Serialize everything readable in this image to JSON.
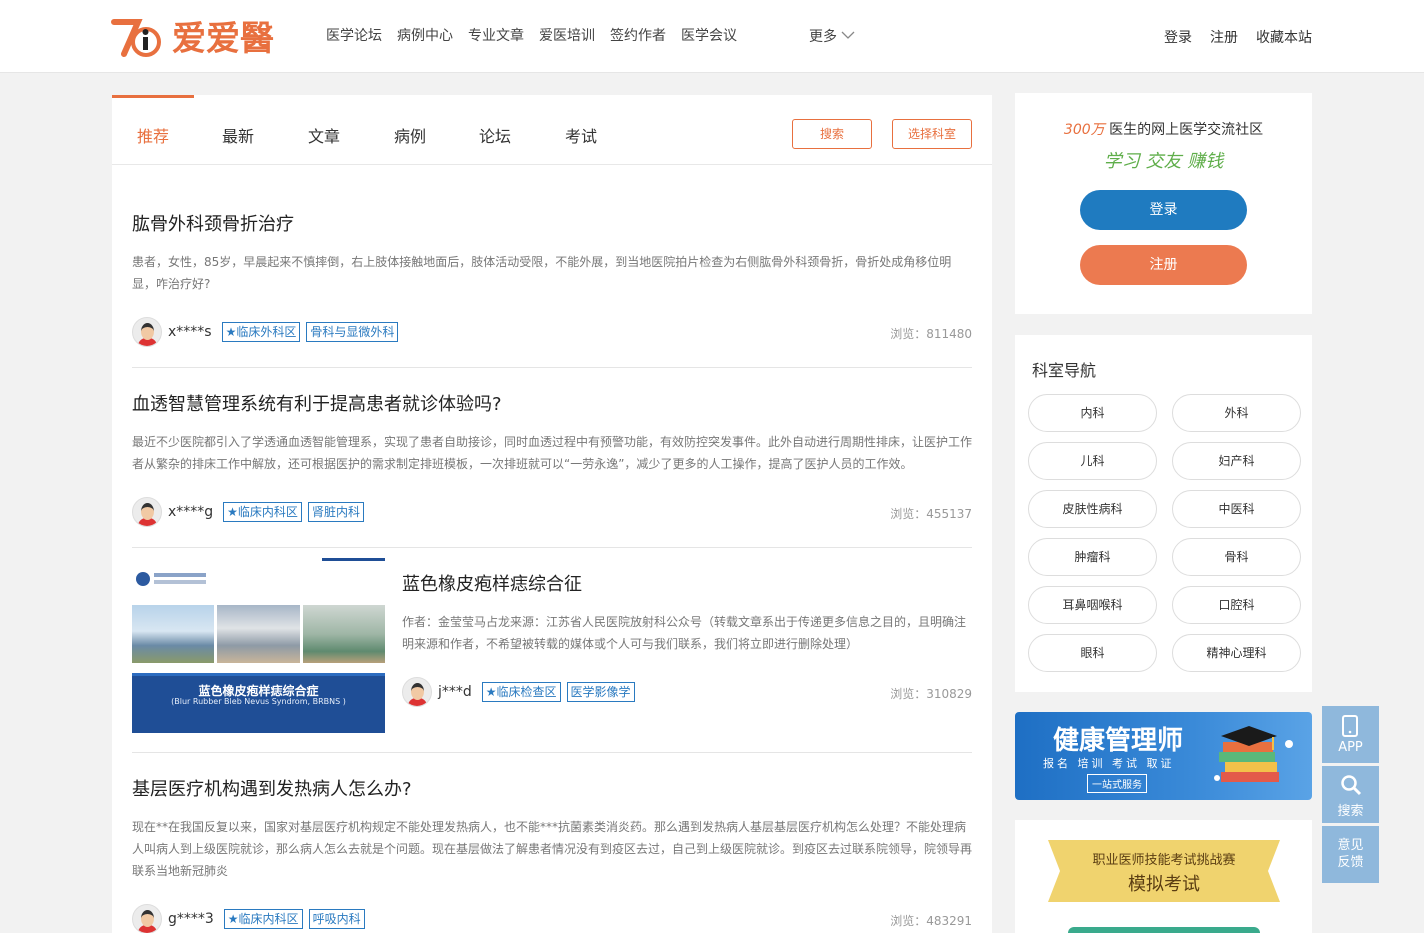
{
  "brand": {
    "logo_text": "爱爱醫"
  },
  "nav": {
    "items": [
      "医学论坛",
      "病例中心",
      "专业文章",
      "爱医培训",
      "签约作者",
      "医学会议"
    ],
    "more": "更多"
  },
  "toplinks": {
    "login": "登录",
    "register": "注册",
    "bookmark": "收藏本站"
  },
  "tabs": {
    "items": [
      "推荐",
      "最新",
      "文章",
      "病例",
      "论坛",
      "考试"
    ],
    "active": "推荐",
    "search_btn": "搜索",
    "choose_dept_btn": "选择科室"
  },
  "posts": [
    {
      "title": "肱骨外科颈骨折治疗",
      "excerpt": "患者，女性，85岁，早晨起来不慎摔倒，右上肢体接触地面后，肢体活动受限，不能外展，到当地医院拍片检查为右侧肱骨外科颈骨折，骨折处成角移位明显，咋治疗好?",
      "user": "x****s",
      "tags": [
        "★临床外科区",
        "骨科与显微外科"
      ],
      "views": "浏览：811480"
    },
    {
      "title": "血透智慧管理系统有利于提高患者就诊体验吗?",
      "excerpt": "最近不少医院都引入了学透通血透智能管理系，实现了患者自助接诊，同时血透过程中有预警功能，有效防控突发事件。此外自动进行周期性排床，让医护工作者从繁杂的排床工作中解放，还可根据医护的需求制定排班模板，一次排班就可以“一劳永逸”，减少了更多的人工操作，提高了医护人员的工作效。",
      "user": "x****g",
      "tags": [
        "★临床内科区",
        "肾脏内科"
      ],
      "views": "浏览：455137"
    },
    {
      "title": "蓝色橡皮疱样痣综合征",
      "excerpt": "作者：金莹莹马占龙来源：江苏省人民医院放射科公众号（转载文章系出于传递更多信息之目的，且明确注明来源和作者，不希望被转载的媒体或个人可与我们联系，我们将立即进行删除处理）",
      "user": "j***d",
      "tags": [
        "★临床检查区",
        "医学影像学"
      ],
      "views": "浏览：310829",
      "thumb_title": "蓝色橡皮疱样痣综合症",
      "thumb_subtitle": "(Blur Rubber Bleb Nevus Syndrom, BRBNS )"
    },
    {
      "title": "基层医疗机构遇到发热病人怎么办?",
      "excerpt": "现在**在我国反复以来，国家对基层医疗机构规定不能处理发热病人，也不能***抗菌素类消炎药。那么遇到发热病人基层基层医疗机构怎么处理？不能处理病人叫病人到上级医院就诊，那么病人怎么去就是个问题。现在基层做法了解患者情况没有到疫区去过，自己到上级医院就诊。到疫区去过联系院领导，院领导再联系当地新冠肺炎",
      "user": "g****3",
      "tags": [
        "★临床内科区",
        "呼吸内科"
      ],
      "views": "浏览：483291"
    }
  ],
  "sidebar": {
    "slogan_num": "300万",
    "slogan_text": "医生的网上医学交流社区",
    "slogan_sub": "学习 交友 赚钱",
    "login_btn": "登录",
    "register_btn": "注册",
    "dept_title": "科室导航",
    "depts": [
      "内科",
      "外科",
      "儿科",
      "妇产科",
      "皮肤性病科",
      "中医科",
      "肿瘤科",
      "骨科",
      "耳鼻咽喉科",
      "口腔科",
      "眼科",
      "精神心理科"
    ],
    "ad_title": "健康管理师",
    "ad_sub": "报名 培训 考试 取证",
    "ad_badge": "一站式服务",
    "exam_title": "职业医师技能考试挑战赛",
    "exam_sub": "模拟考试"
  },
  "float": {
    "app": "APP",
    "search": "搜索",
    "feedback1": "意见",
    "feedback2": "反馈"
  },
  "colors": {
    "accent": "#e8703f",
    "blue": "#1f7bc0",
    "tag": "#2a7ac0"
  }
}
